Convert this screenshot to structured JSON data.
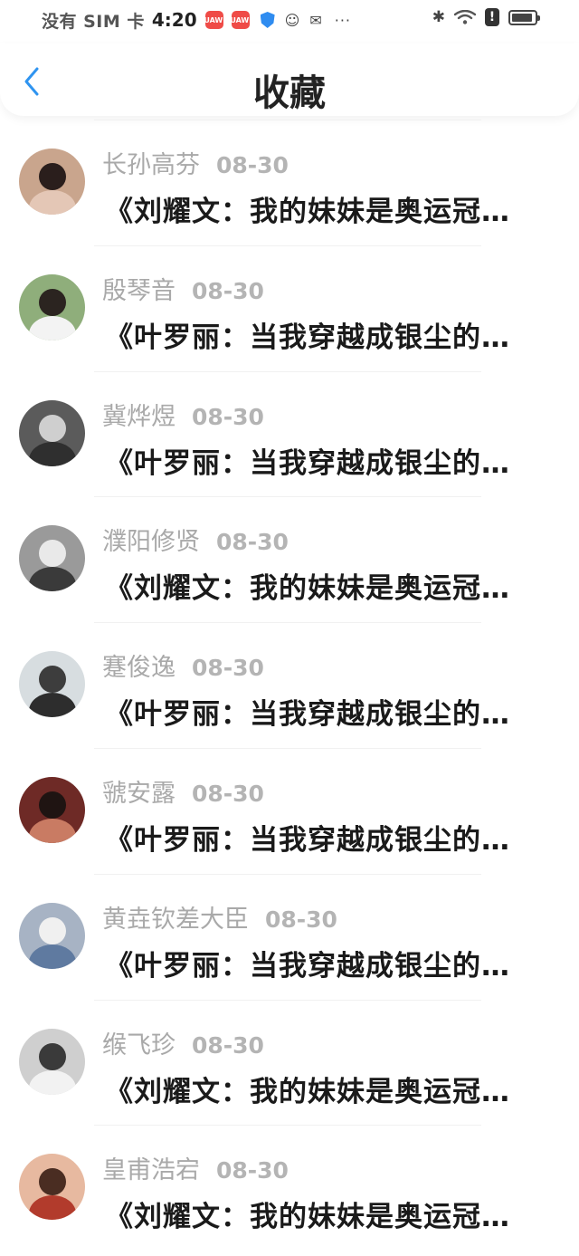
{
  "status_bar": {
    "carrier": "没有 SIM 卡",
    "time": "4:20",
    "app1": "HUAWEI",
    "app2": "HUAWEI",
    "more": "···",
    "alert": "!"
  },
  "header": {
    "title": "收藏"
  },
  "items": [
    {
      "name": "长孙高芬",
      "date": "08-30",
      "title": "《刘耀文：我的妹妹是奥运冠…",
      "avatar_bg": "#c9a58d",
      "avatar_head": "#2a1e1c",
      "avatar_body": "#e4c7b6"
    },
    {
      "name": "殷琴音",
      "date": "08-30",
      "title": "《叶罗丽：当我穿越成银尘的…",
      "avatar_bg": "#8fae7b",
      "avatar_head": "#2b2420",
      "avatar_body": "#f3f3f3"
    },
    {
      "name": "冀烨煜",
      "date": "08-30",
      "title": "《叶罗丽：当我穿越成银尘的…",
      "avatar_bg": "#5b5b5b",
      "avatar_head": "#cfcfcf",
      "avatar_body": "#2f2f2f"
    },
    {
      "name": "濮阳修贤",
      "date": "08-30",
      "title": "《刘耀文：我的妹妹是奥运冠…",
      "avatar_bg": "#9a9a9a",
      "avatar_head": "#e9e9e9",
      "avatar_body": "#3a3a3a"
    },
    {
      "name": "蹇俊逸",
      "date": "08-30",
      "title": "《叶罗丽：当我穿越成银尘的…",
      "avatar_bg": "#d7dde0",
      "avatar_head": "#3d3d3d",
      "avatar_body": "#2d2d2d"
    },
    {
      "name": "虢安露",
      "date": "08-30",
      "title": "《叶罗丽：当我穿越成银尘的…",
      "avatar_bg": "#6e2a26",
      "avatar_head": "#1f1412",
      "avatar_body": "#c97b63"
    },
    {
      "name": "黄垚钦差大臣",
      "date": "08-30",
      "title": "《叶罗丽：当我穿越成银尘的…",
      "avatar_bg": "#a7b3c4",
      "avatar_head": "#f0f0f0",
      "avatar_body": "#5f7aa0"
    },
    {
      "name": "缑飞珍",
      "date": "08-30",
      "title": "《刘耀文：我的妹妹是奥运冠…",
      "avatar_bg": "#cfcfcf",
      "avatar_head": "#3a3a3a",
      "avatar_body": "#f2f2f2"
    },
    {
      "name": "皇甫浩宕",
      "date": "08-30",
      "title": "《刘耀文：我的妹妹是奥运冠…",
      "avatar_bg": "#e7b9a0",
      "avatar_head": "#4a2d22",
      "avatar_body": "#b23b2c"
    }
  ]
}
